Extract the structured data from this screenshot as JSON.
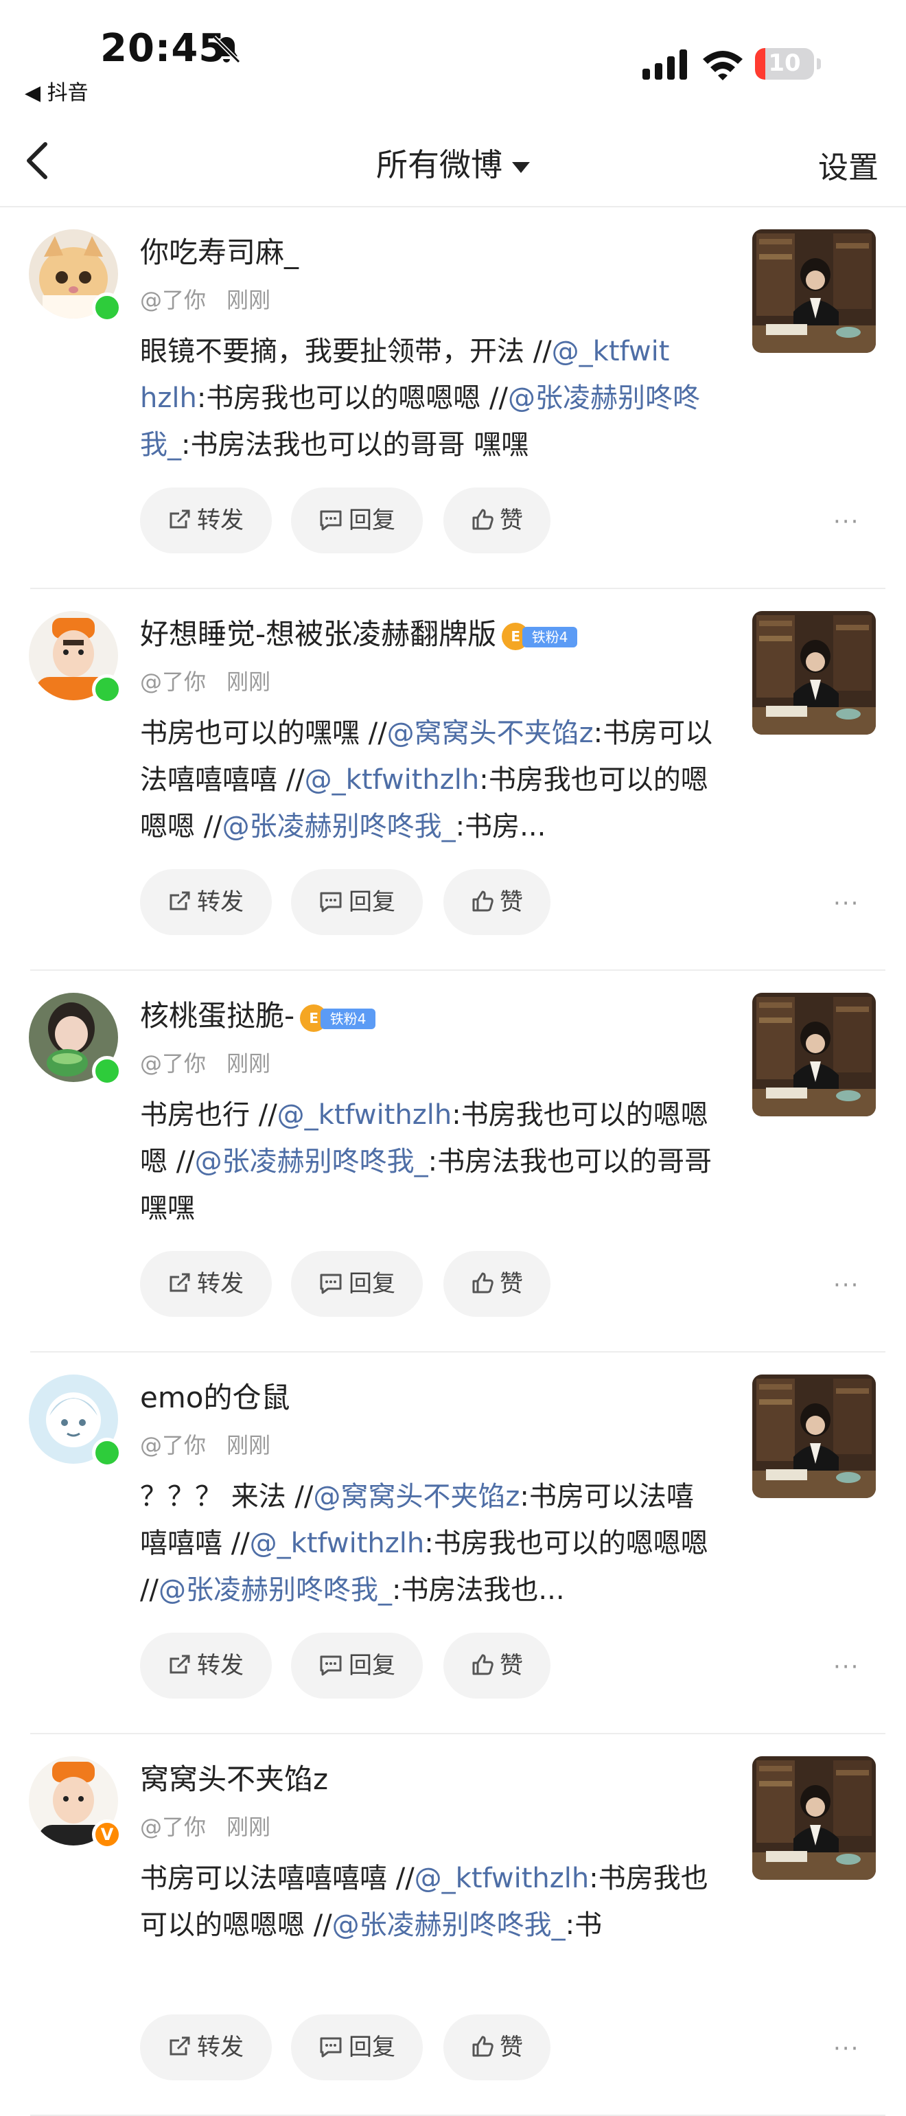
{
  "status_bar": {
    "time": "20:45",
    "back_app_label": "◀ 抖音",
    "battery_level": "10",
    "battery_fraction": 0.1,
    "icons": [
      "bell-slash-icon",
      "cellular-signal-icon",
      "wifi-icon",
      "battery-icon"
    ]
  },
  "nav": {
    "title": "所有微博",
    "settings": "设置",
    "icons": [
      "back-chevron-icon",
      "dropdown-triangle-icon"
    ]
  },
  "actions": {
    "repost": "转发",
    "reply": "回复",
    "like": "赞",
    "more": "···"
  },
  "posts": [
    {
      "username": "你吃寿司麻_",
      "mention_me": "@了你",
      "time": "刚刚",
      "badge": null,
      "avatar_badge": "online",
      "content": [
        {
          "t": "text",
          "v": "眼镜不要摘，我要扯领带，开法 //"
        },
        {
          "t": "mention",
          "v": "@_ktfwit hzlh"
        },
        {
          "t": "text",
          "v": ":书房我也可以的嗯嗯嗯 //"
        },
        {
          "t": "mention",
          "v": "@张凌赫别咚咚我_"
        },
        {
          "t": "text",
          "v": ":书房法我也可以的哥哥 嘿嘿"
        }
      ]
    },
    {
      "username": "好想睡觉-想被张凌赫翻牌版",
      "mention_me": "@了你",
      "time": "刚刚",
      "badge": {
        "icon_text": "E",
        "label": "铁粉4"
      },
      "avatar_badge": "online",
      "content": [
        {
          "t": "text",
          "v": "书房也可以的嘿嘿 //"
        },
        {
          "t": "mention",
          "v": "@窝窝头不夹馅z"
        },
        {
          "t": "text",
          "v": ":书房可以法嘻嘻嘻嘻 //"
        },
        {
          "t": "mention",
          "v": "@_ktfwithzlh"
        },
        {
          "t": "text",
          "v": ":书房我也可以的嗯嗯嗯 //"
        },
        {
          "t": "mention",
          "v": "@张凌赫别咚咚我_"
        },
        {
          "t": "text",
          "v": ":书房..."
        }
      ]
    },
    {
      "username": "核桃蛋挞脆-",
      "mention_me": "@了你",
      "time": "刚刚",
      "badge": {
        "icon_text": "E",
        "label": "铁粉4"
      },
      "avatar_badge": "online",
      "content": [
        {
          "t": "text",
          "v": "书房也行 //"
        },
        {
          "t": "mention",
          "v": "@_ktfwithzlh"
        },
        {
          "t": "text",
          "v": ":书房我也可以的嗯嗯嗯 //"
        },
        {
          "t": "mention",
          "v": "@张凌赫别咚咚我_"
        },
        {
          "t": "text",
          "v": ":书房法我也可以的哥哥 嘿嘿"
        }
      ]
    },
    {
      "username": "emo的仓鼠",
      "mention_me": "@了你",
      "time": "刚刚",
      "badge": null,
      "avatar_badge": "online",
      "content": [
        {
          "t": "text",
          "v": "？？？ 来法 //"
        },
        {
          "t": "mention",
          "v": "@窝窝头不夹馅z"
        },
        {
          "t": "text",
          "v": ":书房可以法嘻嘻嘻嘻 //"
        },
        {
          "t": "mention",
          "v": "@_ktfwithzlh"
        },
        {
          "t": "text",
          "v": ":书房我也可以的嗯嗯嗯 //"
        },
        {
          "t": "mention",
          "v": "@张凌赫别咚咚我_"
        },
        {
          "t": "text",
          "v": ":书房法我也..."
        }
      ]
    },
    {
      "username": "窝窝头不夹馅z",
      "mention_me": "@了你",
      "time": "刚刚",
      "badge": null,
      "avatar_badge": "verified",
      "verified_mark": "V",
      "content": [
        {
          "t": "text",
          "v": "书房可以法嘻嘻嘻嘻 //"
        },
        {
          "t": "mention",
          "v": "@_ktfwithzlh"
        },
        {
          "t": "text",
          "v": ":书房我也可以的嗯嗯嗯 //"
        },
        {
          "t": "mention",
          "v": "@张凌赫别咚咚我_"
        },
        {
          "t": "text",
          "v": ":书"
        }
      ]
    }
  ]
}
